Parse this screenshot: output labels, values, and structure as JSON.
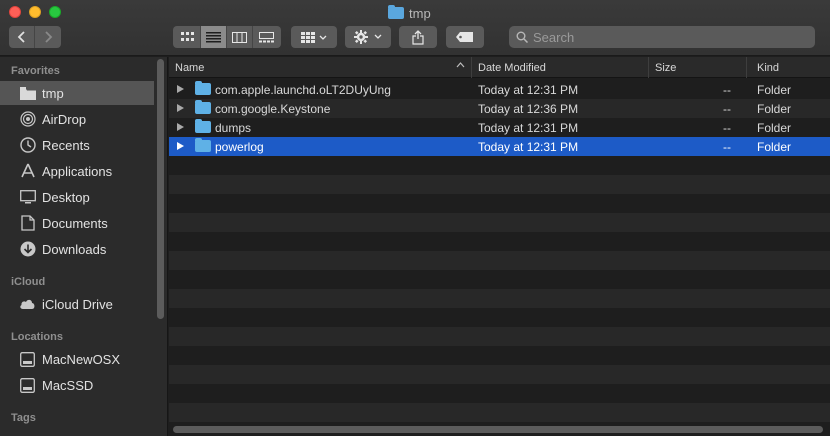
{
  "window": {
    "title": "tmp"
  },
  "toolbar": {
    "back_icon": "chevron-left-icon",
    "forward_icon": "chevron-right-icon",
    "views": [
      "icon-view-icon",
      "list-view-icon",
      "column-view-icon",
      "gallery-view-icon"
    ],
    "active_view": "list",
    "search_placeholder": "Search"
  },
  "sidebar": {
    "favorites_label": "Favorites",
    "favorites": [
      {
        "label": "tmp",
        "icon": "folder-icon"
      },
      {
        "label": "AirDrop",
        "icon": "airdrop-icon"
      },
      {
        "label": "Recents",
        "icon": "clock-icon"
      },
      {
        "label": "Applications",
        "icon": "applications-icon"
      },
      {
        "label": "Desktop",
        "icon": "desktop-icon"
      },
      {
        "label": "Documents",
        "icon": "document-icon"
      },
      {
        "label": "Downloads",
        "icon": "download-icon"
      }
    ],
    "icloud_label": "iCloud",
    "icloud": [
      {
        "label": "iCloud Drive",
        "icon": "cloud-icon"
      }
    ],
    "locations_label": "Locations",
    "locations": [
      {
        "label": "MacNewOSX",
        "icon": "disk-icon"
      },
      {
        "label": "MacSSD",
        "icon": "disk-icon"
      }
    ],
    "tags_label": "Tags"
  },
  "columns": {
    "name": "Name",
    "date": "Date Modified",
    "size": "Size",
    "kind": "Kind"
  },
  "rows": [
    {
      "name": "com.apple.launchd.oLT2DUyUng",
      "date": "Today at 12:31 PM",
      "size": "--",
      "kind": "Folder"
    },
    {
      "name": "com.google.Keystone",
      "date": "Today at 12:36 PM",
      "size": "--",
      "kind": "Folder"
    },
    {
      "name": "dumps",
      "date": "Today at 12:31 PM",
      "size": "--",
      "kind": "Folder"
    },
    {
      "name": "powerlog",
      "date": "Today at 12:31 PM",
      "size": "--",
      "kind": "Folder"
    }
  ],
  "colors": {
    "selection": "#1d5bc7",
    "folder": "#5fb1e6"
  }
}
